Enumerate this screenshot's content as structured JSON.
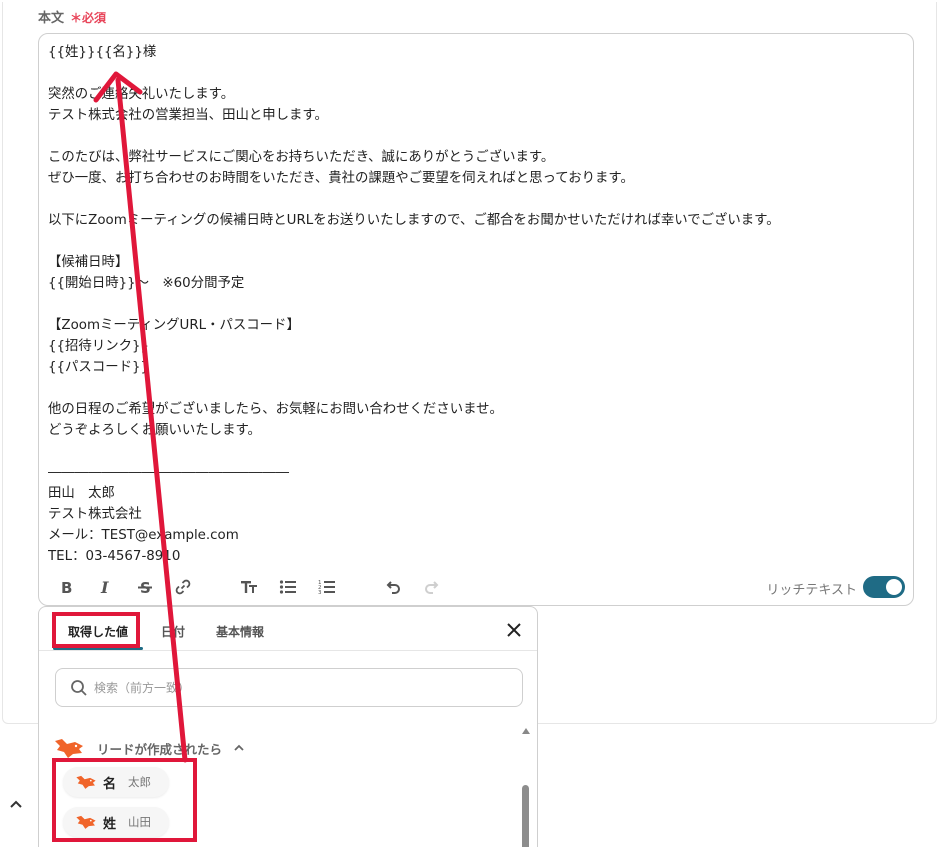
{
  "field": {
    "label": "本文",
    "required_mark": "＊",
    "required_text": "必須"
  },
  "editor": {
    "lines": [
      "{{姓}}{{名}}様",
      "",
      "突然のご連絡失礼いたします。",
      "テスト株式会社の営業担当、田山と申します。",
      "",
      "このたびは、弊社サービスにご関心をお持ちいただき、誠にありがとうございます。",
      "ぜひ一度、お打ち合わせのお時間をいただき、貴社の課題やご要望を伺えればと思っております。",
      "",
      "以下にZoomミーティングの候補日時とURLをお送りいたしますので、ご都合をお聞かせいただければ幸いでございます。",
      "",
      "【候補日時】",
      "{{開始日時}}～　※60分間予定",
      "",
      "【ZoomミーティングURL・パスコード】",
      "{{招待リンク}}",
      "{{パスコード}}",
      "",
      "他の日程のご希望がございましたら、お気軽にお問い合わせくださいませ。",
      "どうぞよろしくお願いいたします。",
      "",
      "――――――――――――――――――",
      "田山　太郎",
      "テスト株式会社",
      "メール：TEST@example.com",
      "TEL：03-4567-8910"
    ],
    "rich_text_label": "リッチテキスト",
    "rich_text_enabled": true
  },
  "popup": {
    "tabs": [
      {
        "label": "取得した値",
        "active": true
      },
      {
        "label": "日付",
        "active": false
      },
      {
        "label": "基本情報",
        "active": false
      }
    ],
    "search_placeholder": "検索（前方一致）",
    "group": {
      "label": "リードが作成されたら",
      "expanded": true
    },
    "items": [
      {
        "name": "名",
        "value": "太郎"
      },
      {
        "name": "姓",
        "value": "山田"
      }
    ]
  },
  "colors": {
    "accent": "#1f6b85",
    "required": "#e8455a",
    "highlight": "#e0173a",
    "fox": "#f0642a"
  }
}
